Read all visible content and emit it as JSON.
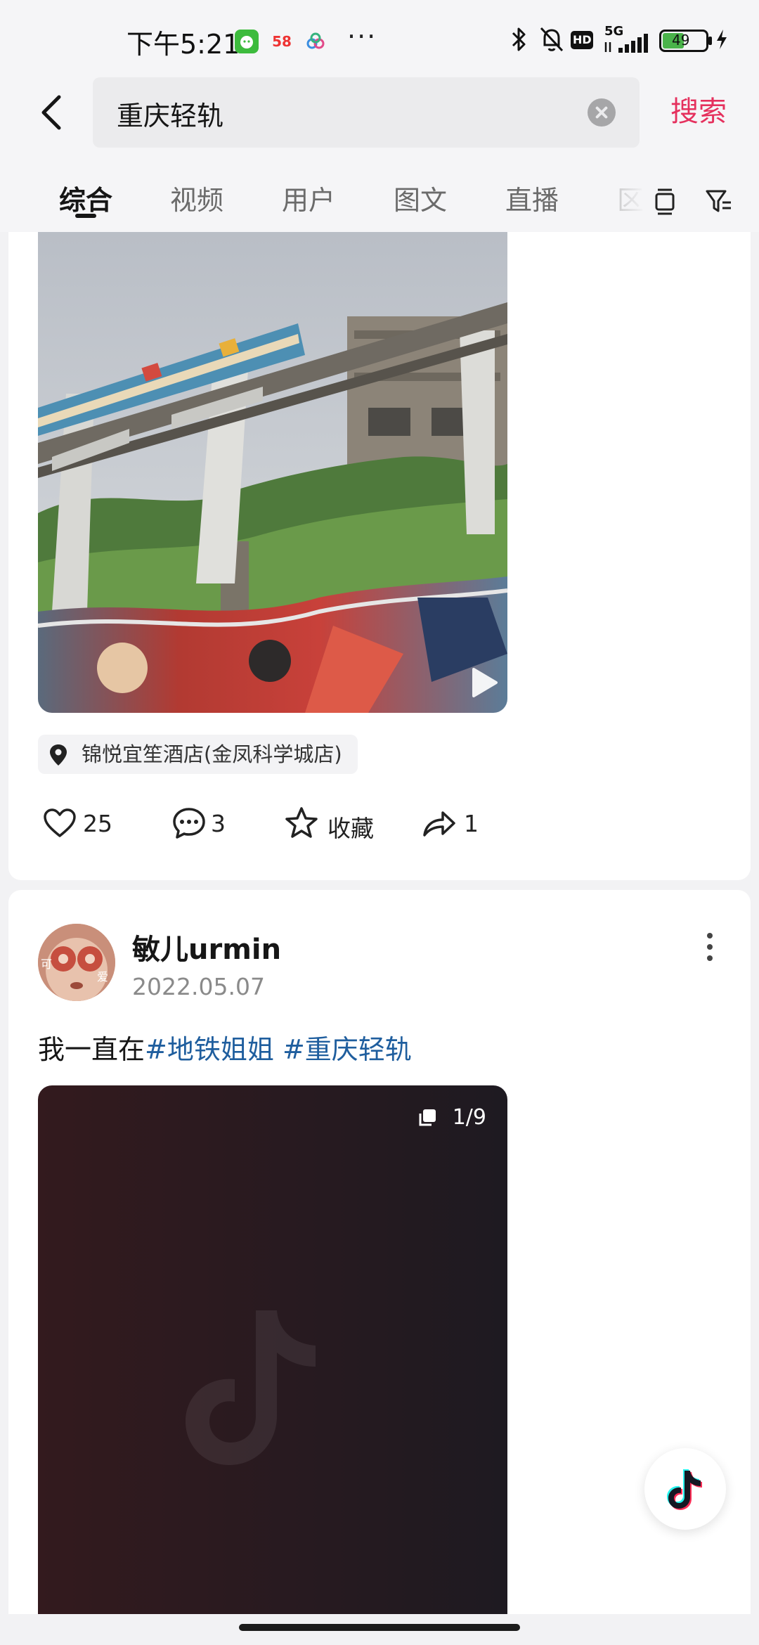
{
  "status_bar": {
    "time": "下午5:21",
    "app_58_label": "58",
    "battery_level": "49",
    "network": "5G",
    "hd_label": "HD",
    "icons": [
      "wechat-app-icon",
      "app-58-icon",
      "cloud-app-icon",
      "bluetooth-icon",
      "mute-bell-icon",
      "signal-icon",
      "battery-icon",
      "charging-icon"
    ]
  },
  "header": {
    "search_query": "重庆轻轨",
    "search_button": "搜索"
  },
  "tabs": {
    "items": [
      {
        "label": "综合",
        "active": true
      },
      {
        "label": "视频",
        "active": false
      },
      {
        "label": "用户",
        "active": false
      },
      {
        "label": "图文",
        "active": false
      },
      {
        "label": "直播",
        "active": false
      },
      {
        "label": "区",
        "active": false
      }
    ]
  },
  "post1": {
    "location": "锦悦宜笙酒店(金凤科学城店)",
    "likes": "25",
    "comments": "3",
    "favorite_label": "收藏",
    "shares": "1"
  },
  "post2": {
    "username": "敏儿urmin",
    "date": "2022.05.07",
    "caption_text": "我一直在",
    "hashtag1": "#地铁姐姐",
    "hashtag2": "#重庆轻轨",
    "image_count": "1/9",
    "avatar_text_left": "可",
    "avatar_text_right": "爱"
  },
  "colors": {
    "accent": "#e5305d",
    "hashtag": "#1f5e9e",
    "background": "#f2f2f4"
  }
}
